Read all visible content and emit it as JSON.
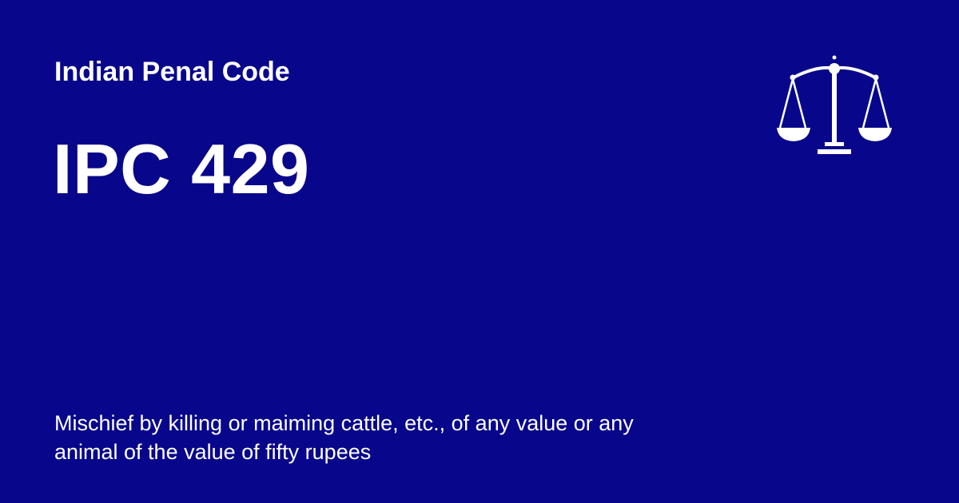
{
  "card": {
    "subtitle": "Indian Penal Code",
    "title": "IPC 429",
    "description": "Mischief by killing or maiming cattle, etc., of any value or any animal of the value of fifty rupees",
    "icon": "scales-of-justice-icon"
  },
  "colors": {
    "background": "#08068a",
    "text": "#ffffff"
  }
}
